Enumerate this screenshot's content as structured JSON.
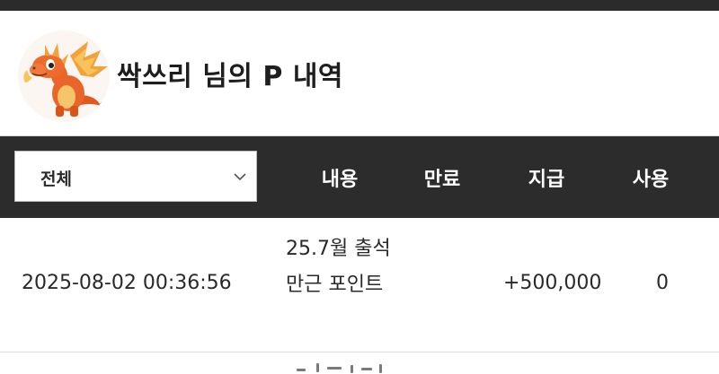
{
  "header": {
    "title": "싹쓰리 님의 P 내역",
    "avatar_icon": "dragon-mascot-icon"
  },
  "table": {
    "filter": {
      "selected": "전체",
      "chevron_icon": "chevron-down-icon"
    },
    "columns": {
      "content": "내용",
      "expire": "만료",
      "give": "지급",
      "use": "사용"
    },
    "rows": [
      {
        "date": "2025-08-02 00:36:56",
        "content": "25.7월 출석 만근 포인트",
        "give": "+500,000",
        "use": "0"
      }
    ]
  },
  "colors": {
    "header_bg": "#2c2c2c",
    "top_bar": "#2b2b2b",
    "dragon_orange": "#e9652a"
  }
}
